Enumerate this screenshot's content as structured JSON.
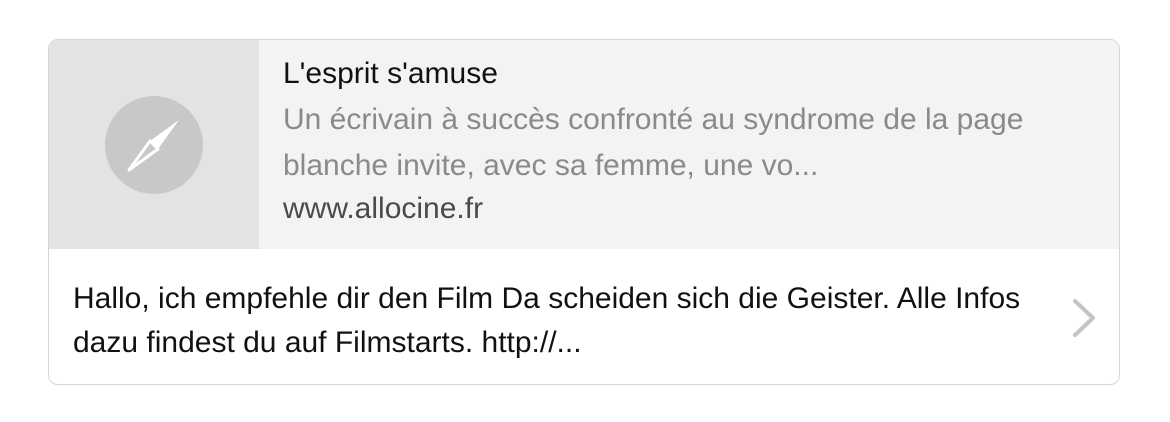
{
  "link_preview": {
    "thumbnail_icon": "compass-icon",
    "title": "L'esprit s'amuse",
    "description": "Un écrivain à succès confronté au syndrome de la page blanche invite, avec sa femme, une vo...",
    "url": "www.allocine.fr"
  },
  "message": {
    "text": "Hallo, ich empfehle dir den Film Da scheiden sich die Geister. Alle Infos dazu findest du auf Filmstarts. http://...",
    "disclosure_icon": "chevron-right-icon"
  },
  "colors": {
    "preview_background": "#f3f3f3",
    "thumbnail_background": "#e3e3e3",
    "compass_circle": "#c8c8c8",
    "title_text": "#111111",
    "description_text": "#8a8a8a",
    "url_text": "#4a4a4a",
    "chevron": "#c4c4c8",
    "border": "#d6d6d6"
  }
}
